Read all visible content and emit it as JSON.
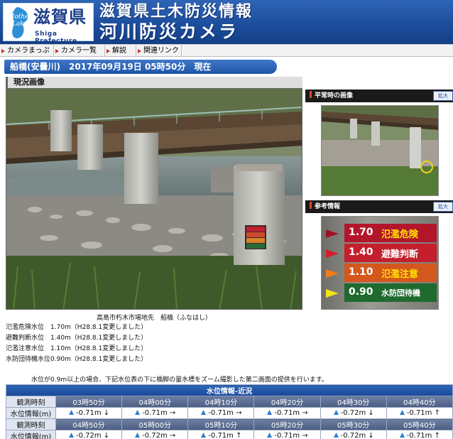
{
  "header": {
    "mother_lake": "Mother Lake",
    "pref_name": "滋賀県",
    "pref_en": "Shiga Prefecture",
    "title_line1": "滋賀県土木防災情報",
    "title_line2": "河川防災カメラ"
  },
  "nav": {
    "items": [
      "カメラまっぷ",
      "カメラ一覧",
      "解説",
      "関連リンク"
    ]
  },
  "station": {
    "text": "船橋(安曇川)　2017年09月19日 05時50分　現在"
  },
  "main": {
    "section_label": "現況画像",
    "caption": "高島市朽木市場地先　船橋（ふなはし）",
    "levels": [
      "氾濫危険水位　1.70m（H28.8.1変更しました）",
      "避難判断水位　1.40m（H28.8.1変更しました）",
      "氾濫注意水位　1.10m（H28.8.1変更しました）",
      "水防団待機水位0.90m（H28.8.1変更しました）"
    ],
    "note": "水位が0.9m以上の場合、下記水位表の下に橋脚の量水標をズーム撮影した第二画面の提供を行います。"
  },
  "side": {
    "normal_label": "平常時の画像",
    "normal_button": "拡大",
    "ref_label": "参考情報",
    "ref_button": "拡大",
    "gauge": [
      {
        "value": "1.70",
        "text": "氾濫危険",
        "color": "#b3162b"
      },
      {
        "value": "1.40",
        "text": "避難判断",
        "color": "#c51e2c"
      },
      {
        "value": "1.10",
        "text": "氾濫注意",
        "color": "#d4571d"
      },
      {
        "value": "0.90",
        "text": "水防団待機",
        "color": "#1f6a2e"
      }
    ]
  },
  "water_table": {
    "caption": "水位情報-近況",
    "row_time_label": "観測時刻",
    "row_level_label": "水位情報(m)",
    "rows": [
      {
        "times": [
          "03時50分",
          "04時00分",
          "04時10分",
          "04時20分",
          "04時30分",
          "04時40分"
        ],
        "levels": [
          "-0.71m ↓",
          "-0.71m →",
          "-0.71m →",
          "-0.71m →",
          "-0.72m ↓",
          "-0.71m ↑"
        ]
      },
      {
        "times": [
          "04時50分",
          "05時00分",
          "05時10分",
          "05時20分",
          "05時30分",
          "05時40分"
        ],
        "levels": [
          "-0.72m ↓",
          "-0.72m →",
          "-0.71m ↑",
          "-0.71m →",
          "-0.72m ↓",
          "-0.71m ↑"
        ]
      }
    ]
  }
}
